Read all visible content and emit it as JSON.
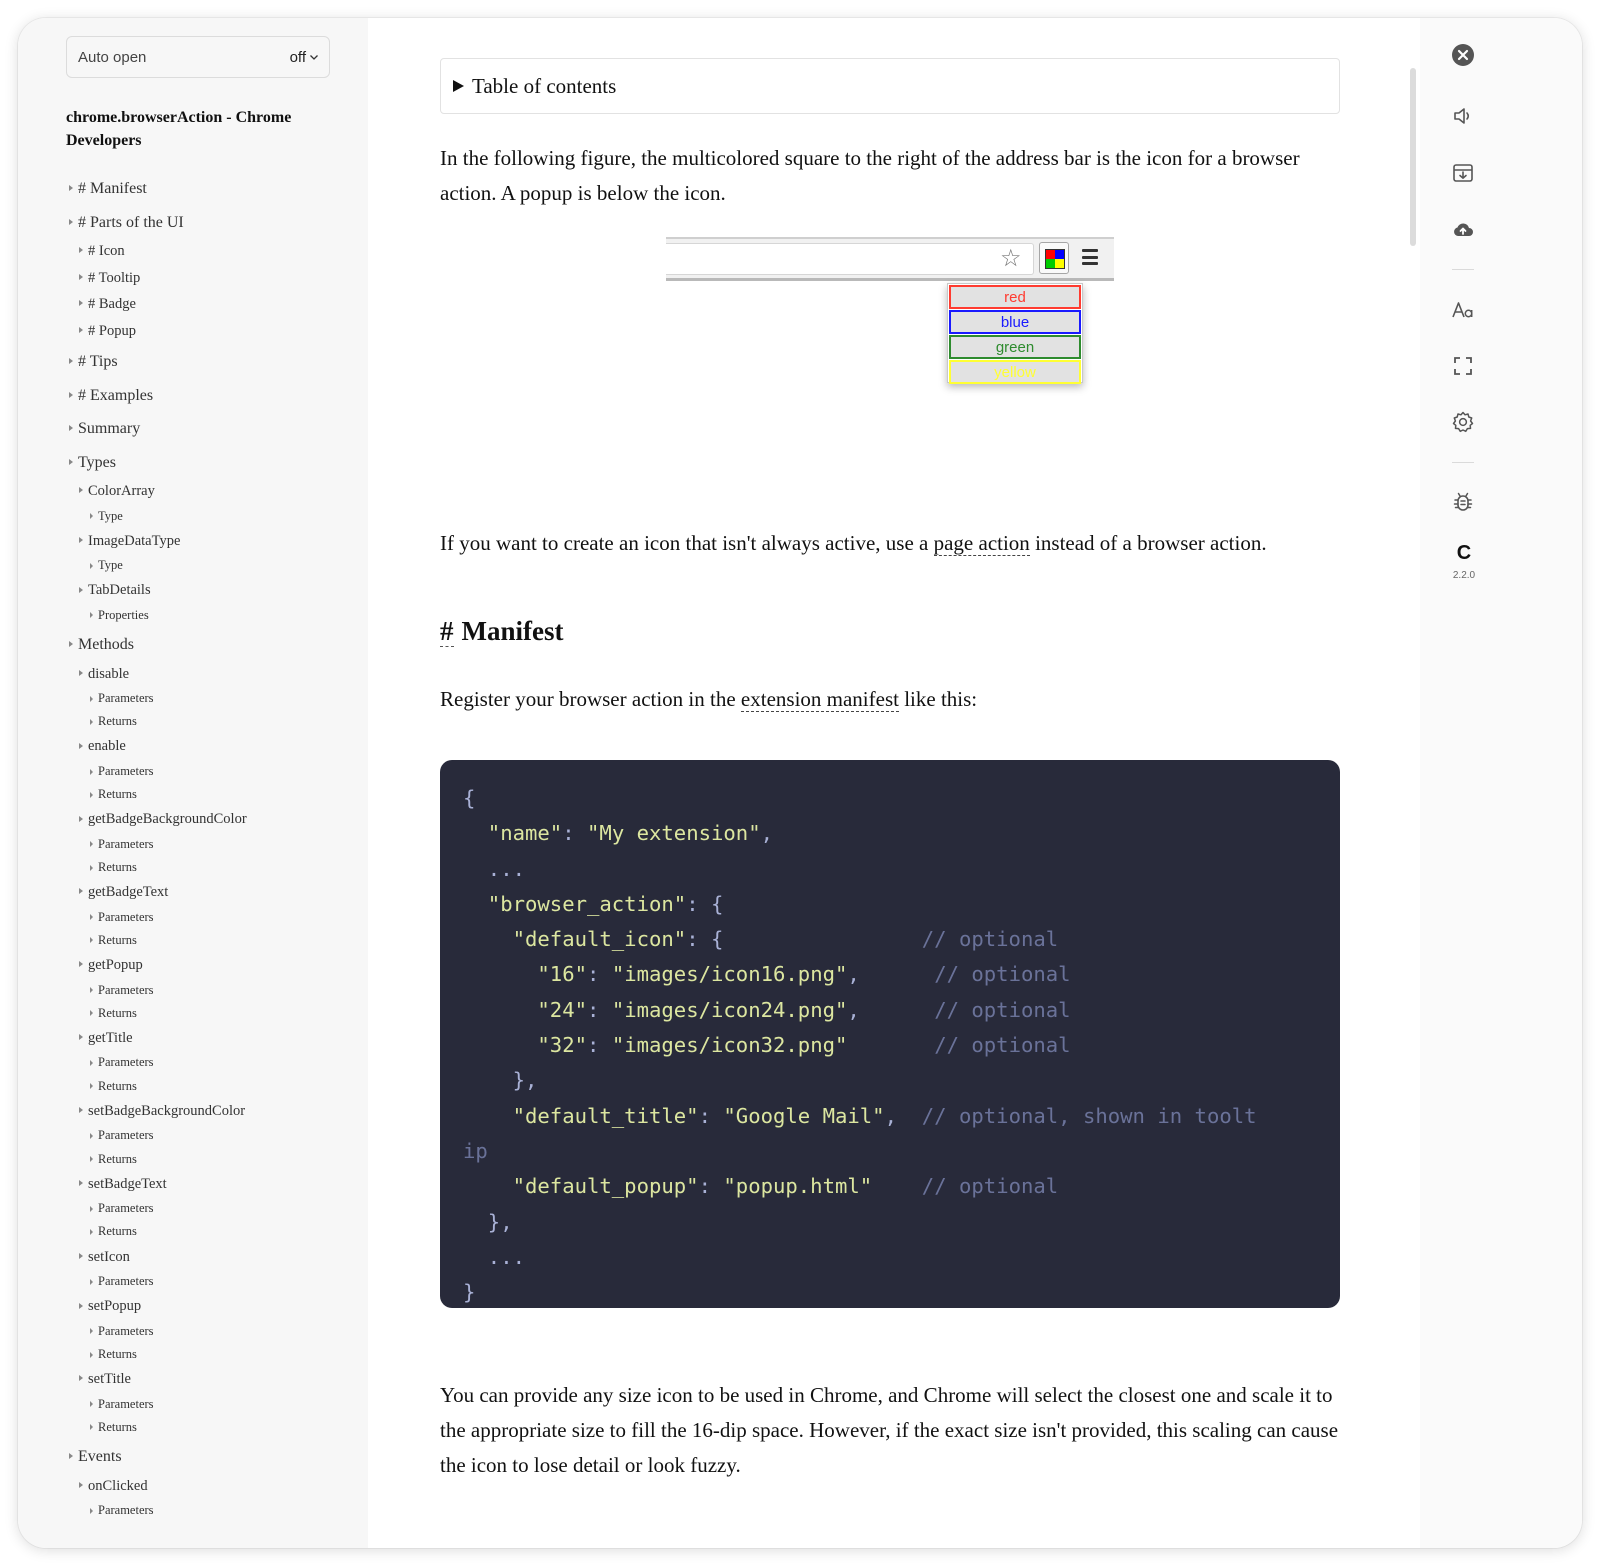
{
  "sidebar": {
    "auto_open": {
      "label": "Auto open",
      "value": "off"
    },
    "doc_title": "chrome.browserAction - Chrome Developers",
    "toc": [
      {
        "label": "# Manifest",
        "level": 1
      },
      {
        "label": "# Parts of the UI",
        "level": 1
      },
      {
        "label": "# Icon",
        "level": 2
      },
      {
        "label": "# Tooltip",
        "level": 2
      },
      {
        "label": "# Badge",
        "level": 2
      },
      {
        "label": "# Popup",
        "level": 2
      },
      {
        "label": "# Tips",
        "level": 1
      },
      {
        "label": "# Examples",
        "level": 1
      },
      {
        "label": "Summary",
        "level": 1
      },
      {
        "label": "Types",
        "level": 1
      },
      {
        "label": "ColorArray",
        "level": 2
      },
      {
        "label": "Type",
        "level": 3
      },
      {
        "label": "ImageDataType",
        "level": 2
      },
      {
        "label": "Type",
        "level": 3
      },
      {
        "label": "TabDetails",
        "level": 2
      },
      {
        "label": "Properties",
        "level": 3
      },
      {
        "label": "Methods",
        "level": 1
      },
      {
        "label": "disable",
        "level": 2
      },
      {
        "label": "Parameters",
        "level": 3
      },
      {
        "label": "Returns",
        "level": 3
      },
      {
        "label": "enable",
        "level": 2
      },
      {
        "label": "Parameters",
        "level": 3
      },
      {
        "label": "Returns",
        "level": 3
      },
      {
        "label": "getBadgeBackgroundColor",
        "level": 2
      },
      {
        "label": "Parameters",
        "level": 3
      },
      {
        "label": "Returns",
        "level": 3
      },
      {
        "label": "getBadgeText",
        "level": 2
      },
      {
        "label": "Parameters",
        "level": 3
      },
      {
        "label": "Returns",
        "level": 3
      },
      {
        "label": "getPopup",
        "level": 2
      },
      {
        "label": "Parameters",
        "level": 3
      },
      {
        "label": "Returns",
        "level": 3
      },
      {
        "label": "getTitle",
        "level": 2
      },
      {
        "label": "Parameters",
        "level": 3
      },
      {
        "label": "Returns",
        "level": 3
      },
      {
        "label": "setBadgeBackgroundColor",
        "level": 2
      },
      {
        "label": "Parameters",
        "level": 3
      },
      {
        "label": "Returns",
        "level": 3
      },
      {
        "label": "setBadgeText",
        "level": 2
      },
      {
        "label": "Parameters",
        "level": 3
      },
      {
        "label": "Returns",
        "level": 3
      },
      {
        "label": "setIcon",
        "level": 2
      },
      {
        "label": "Parameters",
        "level": 3
      },
      {
        "label": "setPopup",
        "level": 2
      },
      {
        "label": "Parameters",
        "level": 3
      },
      {
        "label": "Returns",
        "level": 3
      },
      {
        "label": "setTitle",
        "level": 2
      },
      {
        "label": "Parameters",
        "level": 3
      },
      {
        "label": "Returns",
        "level": 3
      },
      {
        "label": "Events",
        "level": 1
      },
      {
        "label": "onClicked",
        "level": 2
      },
      {
        "label": "Parameters",
        "level": 3
      }
    ]
  },
  "main": {
    "toc_summary": "Table of contents",
    "intro": "In the following figure, the multicolored square to the right of the address bar is the icon for a browser action. A popup is below the icon.",
    "figure": {
      "popup_options": [
        {
          "label": "red",
          "color": "#ff3b30"
        },
        {
          "label": "blue",
          "color": "#1a1aff"
        },
        {
          "label": "green",
          "color": "#2e8b2e"
        },
        {
          "label": "yellow",
          "color": "#ffff33"
        }
      ],
      "icon_colors": [
        "#ff0000",
        "#0000ff",
        "#00cc00",
        "#ffff00"
      ]
    },
    "page_action_para": {
      "before": "If you want to create an icon that isn't always active, use a ",
      "link": "page action",
      "after": " instead of a browser action."
    },
    "manifest_heading": {
      "anchor": "#",
      "title": "Manifest"
    },
    "register_para": {
      "before": "Register your browser action in the ",
      "link": "extension manifest",
      "after": " like this:"
    },
    "code_lines": [
      [
        {
          "t": "{",
          "k": "p"
        }
      ],
      [
        {
          "t": "  \"name\"",
          "k": "s"
        },
        {
          "t": ": ",
          "k": "p"
        },
        {
          "t": "\"My extension\"",
          "k": "s"
        },
        {
          "t": ",",
          "k": "p"
        }
      ],
      [
        {
          "t": "  ...",
          "k": "p"
        }
      ],
      [
        {
          "t": "  \"browser_action\"",
          "k": "s"
        },
        {
          "t": ": {",
          "k": "p"
        }
      ],
      [
        {
          "t": "    \"default_icon\"",
          "k": "s"
        },
        {
          "t": ": {                ",
          "k": "p"
        },
        {
          "t": "// optional",
          "k": "c"
        }
      ],
      [
        {
          "t": "      \"16\"",
          "k": "s"
        },
        {
          "t": ": ",
          "k": "p"
        },
        {
          "t": "\"images/icon16.png\"",
          "k": "s"
        },
        {
          "t": ",      ",
          "k": "p"
        },
        {
          "t": "// optional",
          "k": "c"
        }
      ],
      [
        {
          "t": "      \"24\"",
          "k": "s"
        },
        {
          "t": ": ",
          "k": "p"
        },
        {
          "t": "\"images/icon24.png\"",
          "k": "s"
        },
        {
          "t": ",      ",
          "k": "p"
        },
        {
          "t": "// optional",
          "k": "c"
        }
      ],
      [
        {
          "t": "      \"32\"",
          "k": "s"
        },
        {
          "t": ": ",
          "k": "p"
        },
        {
          "t": "\"images/icon32.png\"",
          "k": "s"
        },
        {
          "t": "       ",
          "k": "p"
        },
        {
          "t": "// optional",
          "k": "c"
        }
      ],
      [
        {
          "t": "    },",
          "k": "p"
        }
      ],
      [
        {
          "t": "    \"default_title\"",
          "k": "s"
        },
        {
          "t": ": ",
          "k": "p"
        },
        {
          "t": "\"Google Mail\"",
          "k": "s"
        },
        {
          "t": ",  ",
          "k": "p"
        },
        {
          "t": "// optional, shown in toolt",
          "k": "c"
        }
      ],
      [
        {
          "t": "ip",
          "k": "c"
        }
      ],
      [
        {
          "t": "    \"default_popup\"",
          "k": "s"
        },
        {
          "t": ": ",
          "k": "p"
        },
        {
          "t": "\"popup.html\"",
          "k": "s"
        },
        {
          "t": "    ",
          "k": "p"
        },
        {
          "t": "// optional",
          "k": "c"
        }
      ],
      [
        {
          "t": "  },",
          "k": "p"
        }
      ],
      [
        {
          "t": "  ...",
          "k": "p"
        }
      ],
      [
        {
          "t": "}",
          "k": "p"
        }
      ]
    ],
    "size_para": "You can provide any size icon to be used in Chrome, and Chrome will select the closest one and scale it to the appropriate size to fill the 16-dip space. However, if the exact size isn't provided, this scaling can cause the icon to lose detail or look fuzzy."
  },
  "toolbar": {
    "buttons": [
      "close-icon",
      "speaker-icon",
      "archive-icon",
      "cloud-upload-icon",
      "font-icon",
      "fullscreen-icon",
      "settings-icon",
      "bug-icon"
    ],
    "logo": "C",
    "version": "2.2.0"
  }
}
